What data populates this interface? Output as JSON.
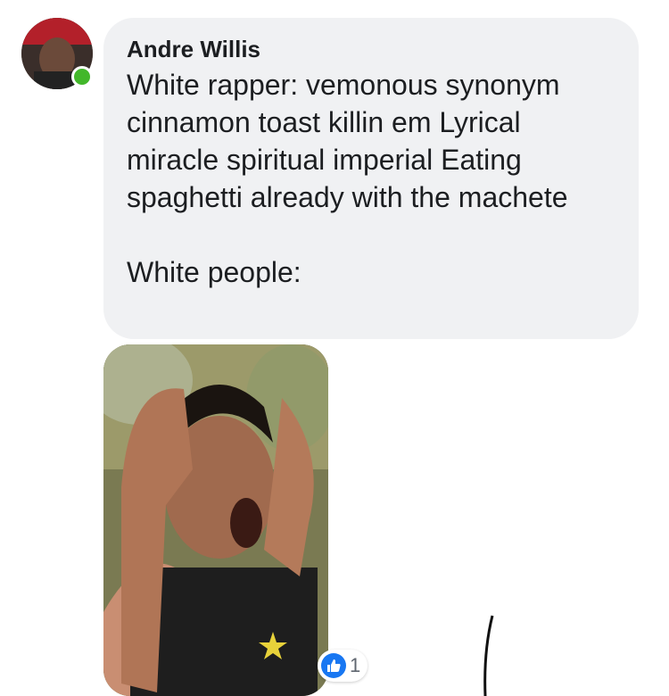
{
  "comment": {
    "author": "Andre Willis",
    "message": "White rapper: vemonous synonym cinnamon toast killin em Lyrical miracle spiritual imperial Eating spaghetti already with the machete\n\nWhite people:",
    "online": true
  },
  "attachment": {
    "type": "photo"
  },
  "reactions": {
    "icon": "like-icon",
    "count": "1",
    "color": "#1877f2"
  },
  "colors": {
    "bubble": "#f0f1f3",
    "text": "#1c1e21",
    "online": "#42b72a"
  }
}
